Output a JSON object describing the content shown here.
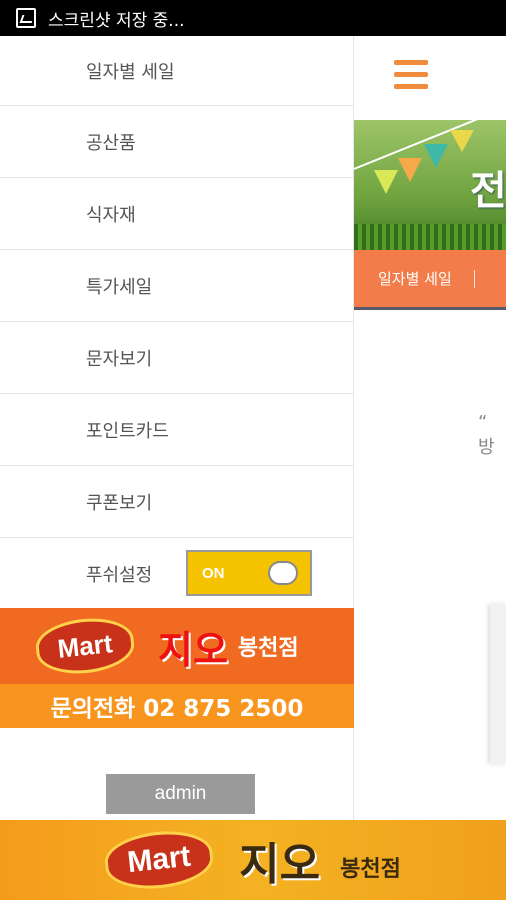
{
  "status_bar": {
    "text": "스크린샷 저장 중..."
  },
  "drawer": {
    "menu_items": [
      {
        "label": "일자별 세일"
      },
      {
        "label": "공산품"
      },
      {
        "label": "식자재"
      },
      {
        "label": "특가세일"
      },
      {
        "label": "문자보기"
      },
      {
        "label": "포인트카드"
      },
      {
        "label": "쿠폰보기"
      }
    ],
    "push": {
      "label": "푸쉬설정",
      "toggle_state": "ON"
    },
    "mart": {
      "logo": "Mart",
      "name": "지오",
      "branch": "봉천점",
      "phone_line": "문의전화 02 875 2500"
    },
    "admin_label": "admin"
  },
  "main": {
    "banner_char": "전",
    "tab_label": "일자별 세일",
    "quote_text": "“ 방"
  },
  "footer": {
    "logo": "Mart",
    "name": "지오",
    "branch": "봉천점"
  },
  "colors": {
    "accent_orange": "#f27c4a",
    "toggle_yellow": "#f5c200",
    "admin_gray": "#9a9a9a"
  }
}
